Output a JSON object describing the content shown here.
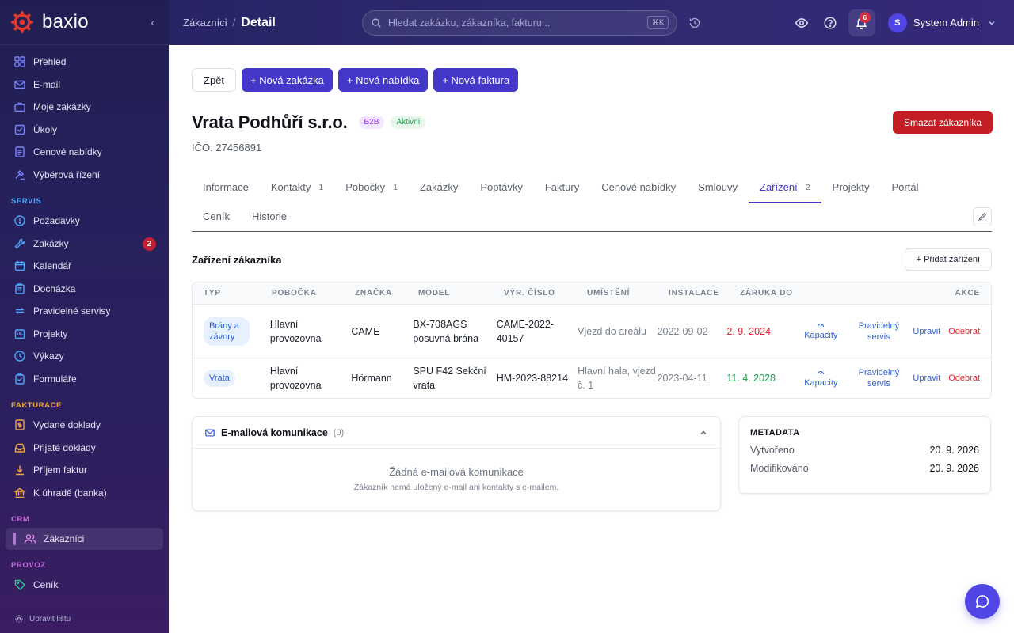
{
  "app": {
    "logo_text": "baxio"
  },
  "sidebar": {
    "items_top": [
      {
        "label": "Přehled",
        "icon": "grid-icon"
      },
      {
        "label": "E-mail",
        "icon": "mail-icon"
      },
      {
        "label": "Moje zakázky",
        "icon": "briefcase-icon"
      },
      {
        "label": "Úkoly",
        "icon": "check-square-icon"
      },
      {
        "label": "Cenové nabídky",
        "icon": "document-icon"
      },
      {
        "label": "Výběrová řízení",
        "icon": "gavel-icon"
      }
    ],
    "section_servis": "SERVIS",
    "items_servis": [
      {
        "label": "Požadavky",
        "icon": "alert-circle-icon"
      },
      {
        "label": "Zakázky",
        "icon": "wrench-icon",
        "badge": "2"
      },
      {
        "label": "Kalendář",
        "icon": "calendar-icon"
      },
      {
        "label": "Docházka",
        "icon": "clipboard-icon"
      },
      {
        "label": "Pravidelné servisy",
        "icon": "repeat-icon"
      },
      {
        "label": "Projekty",
        "icon": "folder-icon"
      },
      {
        "label": "Výkazy",
        "icon": "clock-icon"
      },
      {
        "label": "Formuláře",
        "icon": "form-icon"
      }
    ],
    "section_fakturace": "FAKTURACE",
    "items_fakturace": [
      {
        "label": "Vydané doklady",
        "icon": "dollar-doc-icon"
      },
      {
        "label": "Přijaté doklady",
        "icon": "inbox-icon"
      },
      {
        "label": "Příjem faktur",
        "icon": "download-icon"
      },
      {
        "label": "K úhradě (banka)",
        "icon": "bank-icon"
      }
    ],
    "section_crm": "CRM",
    "items_crm": [
      {
        "label": "Zákazníci",
        "icon": "users-icon"
      }
    ],
    "section_provoz": "PROVOZ",
    "items_provoz": [
      {
        "label": "Ceník",
        "icon": "tag-icon"
      }
    ],
    "footer_label": "Upravit lištu",
    "colors": {
      "servis": "#4ea8ff",
      "fakturace": "#f0a63b",
      "crm": "#c76be0",
      "provoz": "#34c98a"
    }
  },
  "topbar": {
    "breadcrumb_parent": "Zákazníci",
    "breadcrumb_sep": "/",
    "breadcrumb_current": "Detail",
    "search_placeholder": "Hledat zakázku, zákazníka, fakturu...",
    "search_shortcut": "⌘K",
    "notifications_count": "6",
    "avatar_initial": "S",
    "user_name": "System Admin"
  },
  "actions": {
    "back": "Zpět",
    "new_order": "+ Nová zakázka",
    "new_offer": "+ Nová nabídka",
    "new_invoice": "+ Nová faktura",
    "delete_customer": "Smazat zákazníka"
  },
  "customer": {
    "name": "Vrata Podhůří s.r.o.",
    "tag_type": "B2B",
    "tag_status": "Aktivní",
    "ico_line": "IČO: 27456891"
  },
  "tabs": {
    "row1": [
      {
        "label": "Informace"
      },
      {
        "label": "Kontakty",
        "count": "1"
      },
      {
        "label": "Pobočky",
        "count": "1"
      },
      {
        "label": "Zakázky"
      },
      {
        "label": "Poptávky"
      },
      {
        "label": "Faktury"
      },
      {
        "label": "Cenové nabídky"
      },
      {
        "label": "Smlouvy"
      },
      {
        "label": "Zařízení",
        "count": "2",
        "active": true
      },
      {
        "label": "Projekty"
      },
      {
        "label": "Portál"
      }
    ],
    "row2": [
      {
        "label": "Ceník"
      },
      {
        "label": "Historie"
      }
    ]
  },
  "devices": {
    "section_title": "Zařízení zákazníka",
    "add_button": "+ Přidat zařízení",
    "columns": [
      "TYP",
      "POBOČKA",
      "ZNAČKA",
      "MODEL",
      "VÝR. ČÍSLO",
      "UMÍSTĚNÍ",
      "INSTALACE",
      "ZÁRUKA DO",
      "AKCE"
    ],
    "rows": [
      {
        "type": "Brány a závory",
        "branch": "Hlavní provozovna",
        "brand": "CAME",
        "model": "BX-708AGS posuvná brána",
        "serial": "CAME-2022-40157",
        "location": "Vjezd do areálu",
        "installed": "2022-09-02",
        "warranty": "2. 9. 2024",
        "warranty_status": "expired"
      },
      {
        "type": "Vrata",
        "branch": "Hlavní provozovna",
        "brand": "Hörmann",
        "model": "SPU F42 Sekční vrata",
        "serial": "HM-2023-88214",
        "location": "Hlavní hala, vjezd č. 1",
        "installed": "2023-04-11",
        "warranty": "11. 4. 2028",
        "warranty_status": "valid"
      }
    ],
    "actions": {
      "capacity": "Kapacity",
      "regular_service": "Pravidelný servis",
      "edit": "Upravit",
      "remove": "Odebrat"
    }
  },
  "email_section": {
    "title": "E-mailová komunikace",
    "count": "(0)",
    "empty_title": "Žádná e-mailová komunikace",
    "empty_sub": "Zákazník nemá uložený e-mail ani kontakty s e-mailem."
  },
  "metadata": {
    "title": "METADATA",
    "created_label": "Vytvořeno",
    "created_value": "20. 9. 2026",
    "modified_label": "Modifikováno",
    "modified_value": "20. 9. 2026"
  }
}
